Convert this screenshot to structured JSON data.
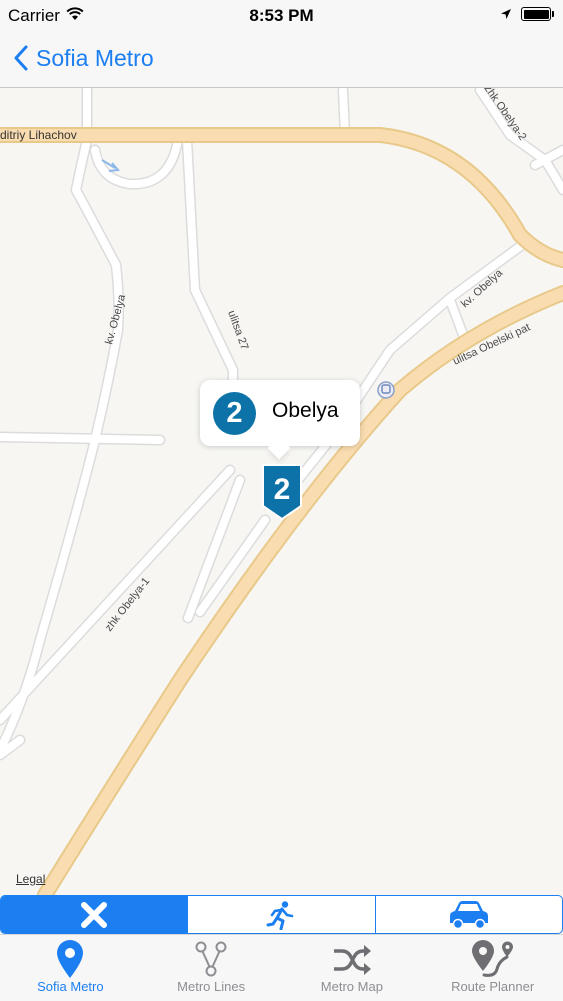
{
  "status_bar": {
    "carrier": "Carrier",
    "time": "8:53 PM"
  },
  "nav": {
    "back_label": "Sofia Metro"
  },
  "map": {
    "street_labels": [
      "ditriy Lihachov",
      "zhk Obelya-2",
      "kv. Obelya",
      "kv. Obelya",
      "ulitsa 27",
      "ulitsa Obelski pat",
      "zhk Obelya-1"
    ],
    "legal": "Legal"
  },
  "station": {
    "line": "2",
    "name": "Obelya",
    "line_color": "#0c72a8"
  },
  "transport_modes": [
    {
      "icon": "close-icon",
      "active": true
    },
    {
      "icon": "walking-icon",
      "active": false
    },
    {
      "icon": "car-icon",
      "active": false
    }
  ],
  "tabs": [
    {
      "label": "Sofia Metro",
      "icon": "location-pin-icon",
      "active": true
    },
    {
      "label": "Metro Lines",
      "icon": "lines-icon",
      "active": false
    },
    {
      "label": "Metro Map",
      "icon": "shuffle-icon",
      "active": false
    },
    {
      "label": "Route Planner",
      "icon": "route-icon",
      "active": false
    }
  ],
  "colors": {
    "accent": "#1b7ff2",
    "map_bg": "#f7f6f3",
    "main_road": "#f7d9a0"
  }
}
